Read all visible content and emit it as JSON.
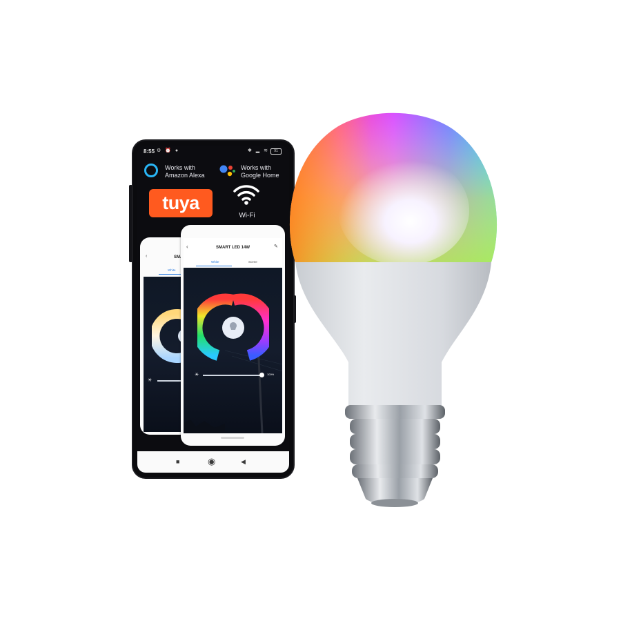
{
  "status": {
    "time": "8:55",
    "left_icons": "⚙ ⏰ ●",
    "right_icons": "✱ ▂ ≋",
    "battery": "91"
  },
  "badges": {
    "alexa": {
      "line1": "Works with",
      "line2": "Amazon Alexa",
      "icon": "amazon-alexa-icon",
      "color": "#29b6f6"
    },
    "google": {
      "line1": "Works with",
      "line2": "Google Home",
      "icon": "google-assistant-icon"
    }
  },
  "brand": {
    "name": "tuya",
    "color": "#ff5a1f"
  },
  "wifi": {
    "label": "Wi-Fi",
    "icon": "wifi-icon"
  },
  "app_back": {
    "title": "SMAR",
    "tab_white": "White",
    "back_icon": "chevron-left-icon"
  },
  "app_front": {
    "title": "SMART LED 14W",
    "tab_white": "White",
    "tab_scene": "Scene",
    "brightness_value": "100%",
    "brightness": 1.0,
    "back_icon": "chevron-left-icon",
    "edit_icon": "pencil-icon"
  },
  "navbar": {
    "recent": "■",
    "home": "◉",
    "back": "◀"
  }
}
